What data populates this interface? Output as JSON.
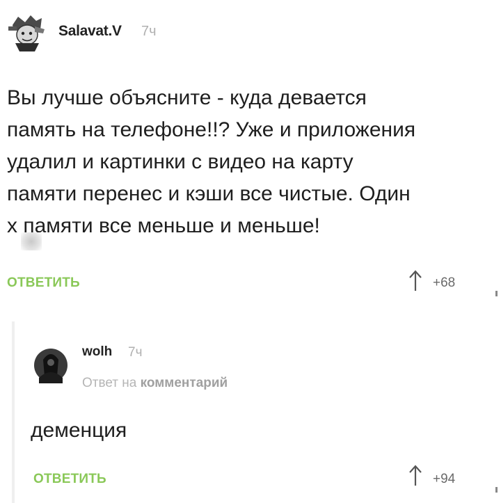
{
  "comment": {
    "username": "Salavat.V",
    "time": "7ч",
    "text_lines": [
      "Вы лучше объясните - куда девается",
      "память на телефоне!!? Уже и приложения",
      "удалил и картинки с видео на карту",
      "памяти перенес и кэши все чистые. Один",
      "х    памяти все меньше и меньше!"
    ],
    "reply_label": "ОТВЕТИТЬ",
    "rating": "+68"
  },
  "reply": {
    "username": "wolh",
    "time": "7ч",
    "reply_to_prefix": "Ответ на",
    "reply_to_link": "комментарий",
    "text": "деменция",
    "reply_label": "ОТВЕТИТЬ",
    "rating": "+94"
  },
  "colors": {
    "accent_green": "#8ac858",
    "muted_gray": "#b0b0b0",
    "text": "#1e1e1e"
  }
}
